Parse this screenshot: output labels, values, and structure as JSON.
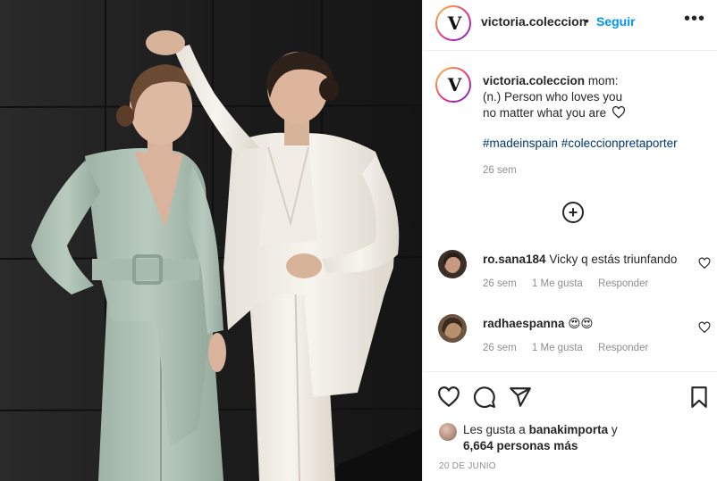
{
  "header": {
    "username": "victoria.coleccion",
    "separator": "•",
    "follow_label": "Seguir",
    "more_label": "•••",
    "avatar_letter": "V"
  },
  "caption": {
    "username": "victoria.coleccion",
    "first_line": "mom:",
    "second_line": "(n.) Person who loves you",
    "third_line": "no matter what you are",
    "hashtags": "#madeinspain #coleccionpretaporter",
    "time": "26 sem"
  },
  "load_more": {
    "icon": "plus-circle-icon",
    "label": "+"
  },
  "comments": [
    {
      "username": "ro.sana184",
      "text": "Vicky q estás triunfando",
      "time": "26 sem",
      "likes": "1 Me gusta",
      "reply": "Responder"
    },
    {
      "username": "radhaespanna",
      "text": "😍😍",
      "time": "26 sem",
      "likes": "1 Me gusta",
      "reply": "Responder"
    }
  ],
  "actions": {
    "icons": [
      "heart-icon",
      "comment-icon",
      "share-icon",
      "bookmark-icon"
    ]
  },
  "likes": {
    "prefix": "Les gusta a",
    "user": "banakimporta",
    "suffix": "y",
    "others": "6,664 personas más"
  },
  "date": "20 DE JUNIO",
  "colors": {
    "accent": "#0095f6",
    "hashtag": "#00376b",
    "muted": "#8e8e8e",
    "text": "#262626",
    "divider": "#efefef"
  }
}
